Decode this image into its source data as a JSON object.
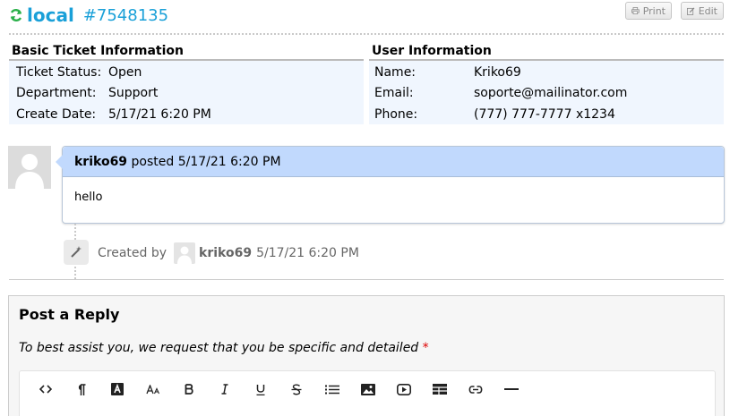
{
  "ticket": {
    "source": "local",
    "number": "#7548135"
  },
  "actions": {
    "print_label": "Print",
    "edit_label": "Edit"
  },
  "basic_info": {
    "heading": "Basic Ticket Information",
    "rows": [
      {
        "label": "Ticket Status:",
        "value": "Open"
      },
      {
        "label": "Department:",
        "value": "Support"
      },
      {
        "label": "Create Date:",
        "value": "5/17/21 6:20 PM"
      }
    ]
  },
  "user_info": {
    "heading": "User Information",
    "rows": [
      {
        "label": "Name:",
        "value": "Kriko69"
      },
      {
        "label": "Email:",
        "value": "soporte@mailinator.com"
      },
      {
        "label": "Phone:",
        "value": "(777) 777-7777 x1234"
      }
    ]
  },
  "thread": {
    "author": "kriko69",
    "posted_text": "posted 5/17/21 6:20 PM",
    "body": "hello"
  },
  "event": {
    "prefix": "Created by",
    "user": "kriko69",
    "timestamp": "5/17/21 6:20 PM"
  },
  "reply": {
    "title": "Post a Reply",
    "note": "To best assist you, we request that you be specific and detailed",
    "required_mark": "*"
  },
  "toolbar_icons": [
    "code-view-icon",
    "paragraph-icon",
    "font-color-icon",
    "font-size-icon",
    "bold-icon",
    "italic-icon",
    "underline-icon",
    "strikethrough-icon",
    "list-icon",
    "image-icon",
    "video-icon",
    "table-icon",
    "link-icon",
    "horizontal-rule-icon"
  ],
  "colors": {
    "accent": "#1aa0d8",
    "thread_header": "#c1d9fd",
    "info_bg": "#f0f6fe",
    "refresh_icon": "#2bb04a"
  }
}
